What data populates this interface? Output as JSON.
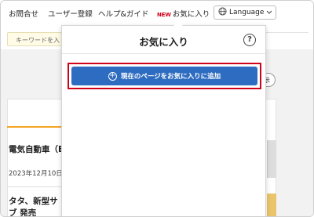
{
  "nav": {
    "contact": "お問合せ",
    "register": "ユーザー登録",
    "help": "ヘルプ&ガイド",
    "favorites_badge": "NEW",
    "favorites": "お気に入り",
    "language": "Language"
  },
  "search": {
    "placeholder": "キーワードを入"
  },
  "background": {
    "show_button": "示",
    "article1_title": "電気自動車（E",
    "article1_date": "2023年12月10日(",
    "article2_title": "タタ、新型サブ 発売"
  },
  "popup": {
    "title": "お気に入り",
    "help_icon": "?",
    "add_button": "現在のページをお気に入りに追加",
    "add_icon": "plus-circle-icon"
  },
  "colors": {
    "accent": "#2d6cc0",
    "highlight": "#d0021b",
    "new_badge": "#d0021b",
    "orange": "#f5a623"
  }
}
